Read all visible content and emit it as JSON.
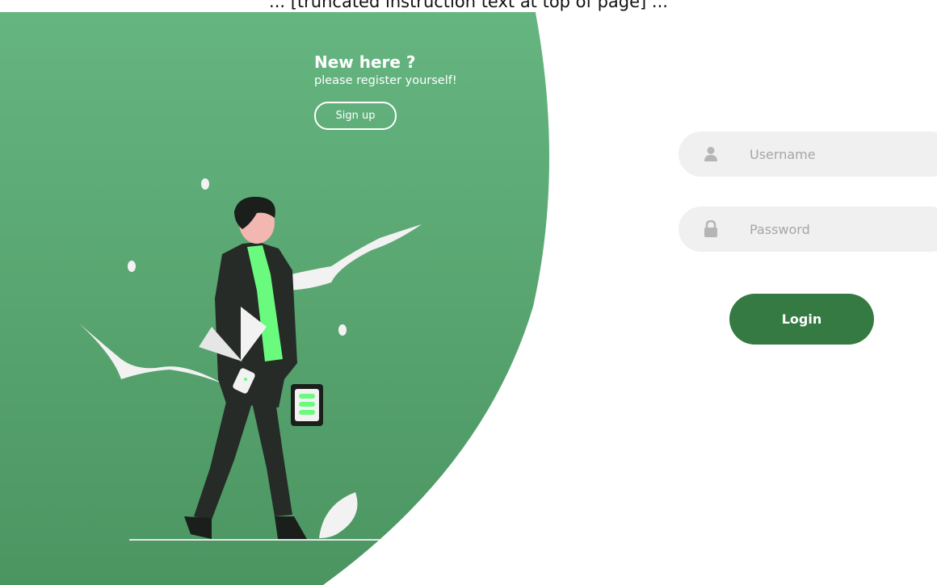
{
  "page_caption": "      ...    [truncated instruction text at top of page]    ...",
  "promo": {
    "title": "New here ?",
    "subtitle": "please register yourself!",
    "signup_label": "Sign up"
  },
  "form": {
    "username_placeholder": "Username",
    "password_placeholder": "Password",
    "login_label": "Login",
    "username_icon": "user-icon",
    "password_icon": "lock-icon"
  },
  "colors": {
    "panel_top": "#66b681",
    "panel_bottom": "#4b9561",
    "login_button": "#357a42",
    "field_bg": "#f0f0f0",
    "placeholder": "#a6a6a6",
    "accent_green": "#6afb7e"
  }
}
